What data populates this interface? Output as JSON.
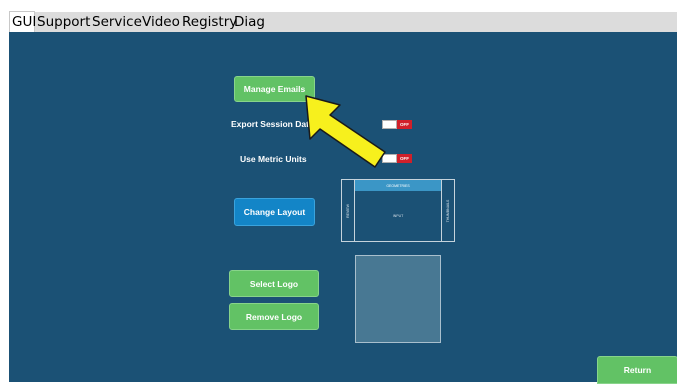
{
  "tabs": [
    "GUI",
    "Support",
    "Service",
    "Video",
    "Registry",
    "Diag"
  ],
  "active_tab": "GUI",
  "buttons": {
    "manage_emails": "Manage Emails",
    "change_layout": "Change Layout",
    "select_logo": "Select Logo",
    "remove_logo": "Remove Logo",
    "return": "Return"
  },
  "settings": {
    "export_session_data": {
      "label": "Export Session Data",
      "state": "OFF"
    },
    "use_metric_units": {
      "label": "Use Metric Units",
      "state": "OFF"
    }
  },
  "layout_preview": {
    "top": "GEOMETRIES",
    "left": "REVIEW",
    "center": "INPUT",
    "right": "THUMBNAILS"
  },
  "colors": {
    "panel_bg": "#1b5175",
    "green_button": "#62c265",
    "blue_button": "#1385c7",
    "toggle_off": "#d0202a",
    "annotation_arrow": "#f7f01d"
  },
  "icons": {
    "annotation": "yellow-arrow-icon"
  }
}
